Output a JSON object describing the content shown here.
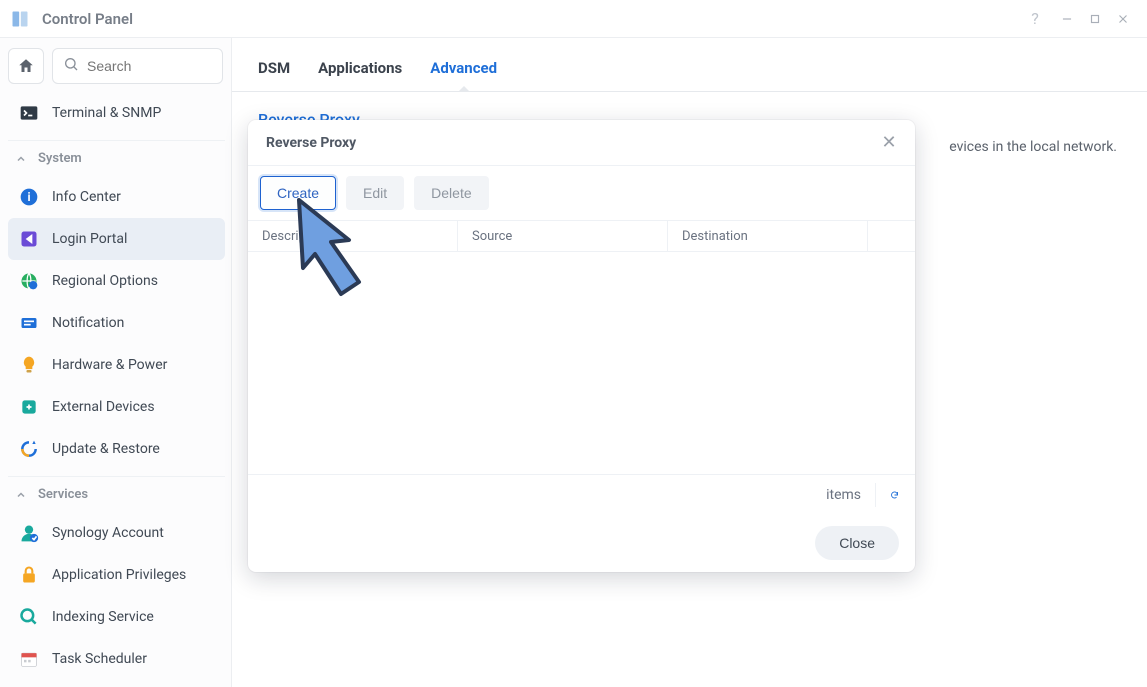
{
  "window": {
    "title": "Control Panel"
  },
  "search": {
    "placeholder": "Search"
  },
  "sidebar": {
    "top_item": {
      "label": "Terminal & SNMP"
    },
    "sections": [
      {
        "label": "System",
        "items": [
          {
            "label": "Info Center"
          },
          {
            "label": "Login Portal"
          },
          {
            "label": "Regional Options"
          },
          {
            "label": "Notification"
          },
          {
            "label": "Hardware & Power"
          },
          {
            "label": "External Devices"
          },
          {
            "label": "Update & Restore"
          }
        ],
        "selected_index": 1
      },
      {
        "label": "Services",
        "items": [
          {
            "label": "Synology Account"
          },
          {
            "label": "Application Privileges"
          },
          {
            "label": "Indexing Service"
          },
          {
            "label": "Task Scheduler"
          }
        ]
      }
    ]
  },
  "tabs": [
    {
      "label": "DSM"
    },
    {
      "label": "Applications"
    },
    {
      "label": "Advanced"
    }
  ],
  "active_tab_index": 2,
  "page": {
    "section_title": "Reverse Proxy",
    "section_desc_tail": "evices in the local network."
  },
  "modal": {
    "title": "Reverse Proxy",
    "buttons": {
      "create": "Create",
      "edit": "Edit",
      "delete": "Delete",
      "close": "Close"
    },
    "columns": {
      "c1": "Description",
      "c2": "Source",
      "c3": "Destination"
    },
    "status_items": "items"
  }
}
